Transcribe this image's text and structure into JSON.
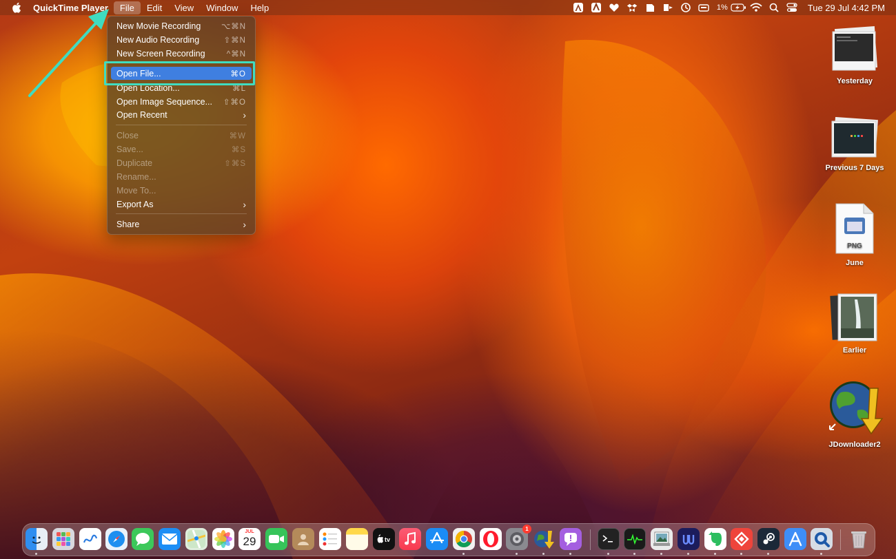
{
  "menubar": {
    "app_name": "QuickTime Player",
    "menus": [
      "File",
      "Edit",
      "View",
      "Window",
      "Help"
    ],
    "active_menu": "File",
    "battery": "1%",
    "clock": "Tue 29 Jul  4:42 PM"
  },
  "file_menu": {
    "items": [
      {
        "label": "New Movie Recording",
        "shortcut": "⌥⌘N",
        "enabled": true
      },
      {
        "label": "New Audio Recording",
        "shortcut": "⇧⌘N",
        "enabled": true
      },
      {
        "label": "New Screen Recording",
        "shortcut": "^⌘N",
        "enabled": true
      },
      {
        "label": "Open File...",
        "shortcut": "⌘O",
        "enabled": true,
        "highlighted": true
      },
      {
        "label": "Open Location...",
        "shortcut": "⌘L",
        "enabled": true
      },
      {
        "label": "Open Image Sequence...",
        "shortcut": "⇧⌘O",
        "enabled": true
      },
      {
        "label": "Open Recent",
        "submenu": true,
        "enabled": true
      },
      {
        "label": "Close",
        "shortcut": "⌘W",
        "enabled": false
      },
      {
        "label": "Save...",
        "shortcut": "⌘S",
        "enabled": false
      },
      {
        "label": "Duplicate",
        "shortcut": "⇧⌘S",
        "enabled": false
      },
      {
        "label": "Rename...",
        "enabled": false
      },
      {
        "label": "Move To...",
        "enabled": false
      },
      {
        "label": "Export As",
        "submenu": true,
        "enabled": true
      },
      {
        "label": "Share",
        "submenu": true,
        "enabled": true
      }
    ]
  },
  "desktop_stacks": [
    {
      "label": "Yesterday"
    },
    {
      "label": "Previous 7 Days"
    },
    {
      "label": "June",
      "file_type": "PNG"
    },
    {
      "label": "Earlier"
    },
    {
      "label": "JDownloader2"
    }
  ],
  "dock": {
    "calendar": {
      "month": "JUL",
      "day": "29"
    },
    "settings_badge": "1",
    "apps": [
      "Finder",
      "Launchpad",
      "Freeform",
      "Safari",
      "Messages",
      "Mail",
      "Maps",
      "Photos",
      "Calendar",
      "FaceTime",
      "Contacts",
      "Reminders",
      "Notes",
      "TV",
      "Music",
      "App Store",
      "Chrome",
      "Opera",
      "System Settings",
      "JDownloader",
      "Feedback",
      "Terminal",
      "Activity Monitor",
      "Preview",
      "Ulysses",
      "Evernote",
      "AnyDesk",
      "Steam",
      "Xcode Instruments",
      "QuickTime Player",
      "Trash"
    ]
  },
  "colors": {
    "menu_highlight": "#3f7fe0",
    "annotation": "#3fdcc0"
  }
}
